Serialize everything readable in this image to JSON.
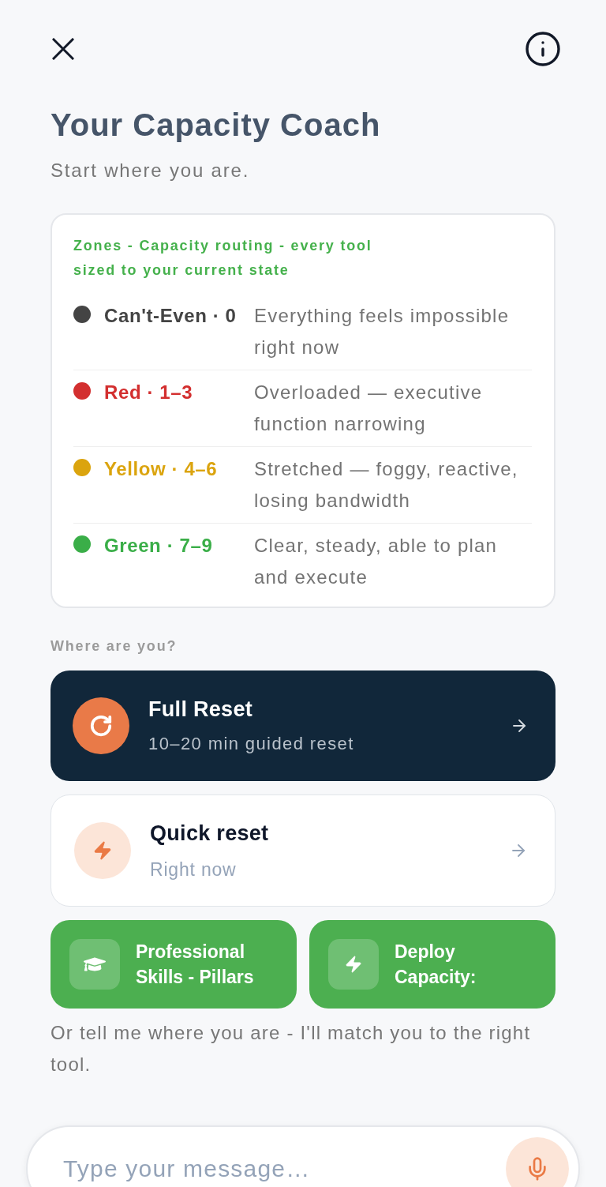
{
  "title": "Your Capacity Coach",
  "subtitle": "Start where you are.",
  "zones_card": {
    "heading": "Zones - Capacity routing - every tool sized to your current state",
    "zones": [
      {
        "label": "Can't-Even · 0",
        "description": "Everything feels impossible right now",
        "color": "#444444"
      },
      {
        "label": "Red · 1–3",
        "description": "Overloaded — executive function narrowing",
        "color": "#d32f2f"
      },
      {
        "label": "Yellow · 4–6",
        "description": "Stretched — foggy, reactive, losing bandwidth",
        "color": "#dba40e"
      },
      {
        "label": "Green · 7–9",
        "description": "Clear, steady, able to plan and execute",
        "color": "#3aae48"
      }
    ]
  },
  "prompt_label": "Where are you?",
  "reset_options": [
    {
      "kind": "primary",
      "title": "Full Reset",
      "subtitle": "10–20 min guided reset"
    },
    {
      "kind": "secondary",
      "title": "Quick reset",
      "subtitle": "Right now"
    }
  ],
  "shortcuts": [
    {
      "label": "Professional Skills - Pillars"
    },
    {
      "label": "Deploy Capacity:"
    }
  ],
  "hint": "Or tell me where you are - I'll match you to the right tool.",
  "composer": {
    "placeholder": "Type your message…"
  }
}
